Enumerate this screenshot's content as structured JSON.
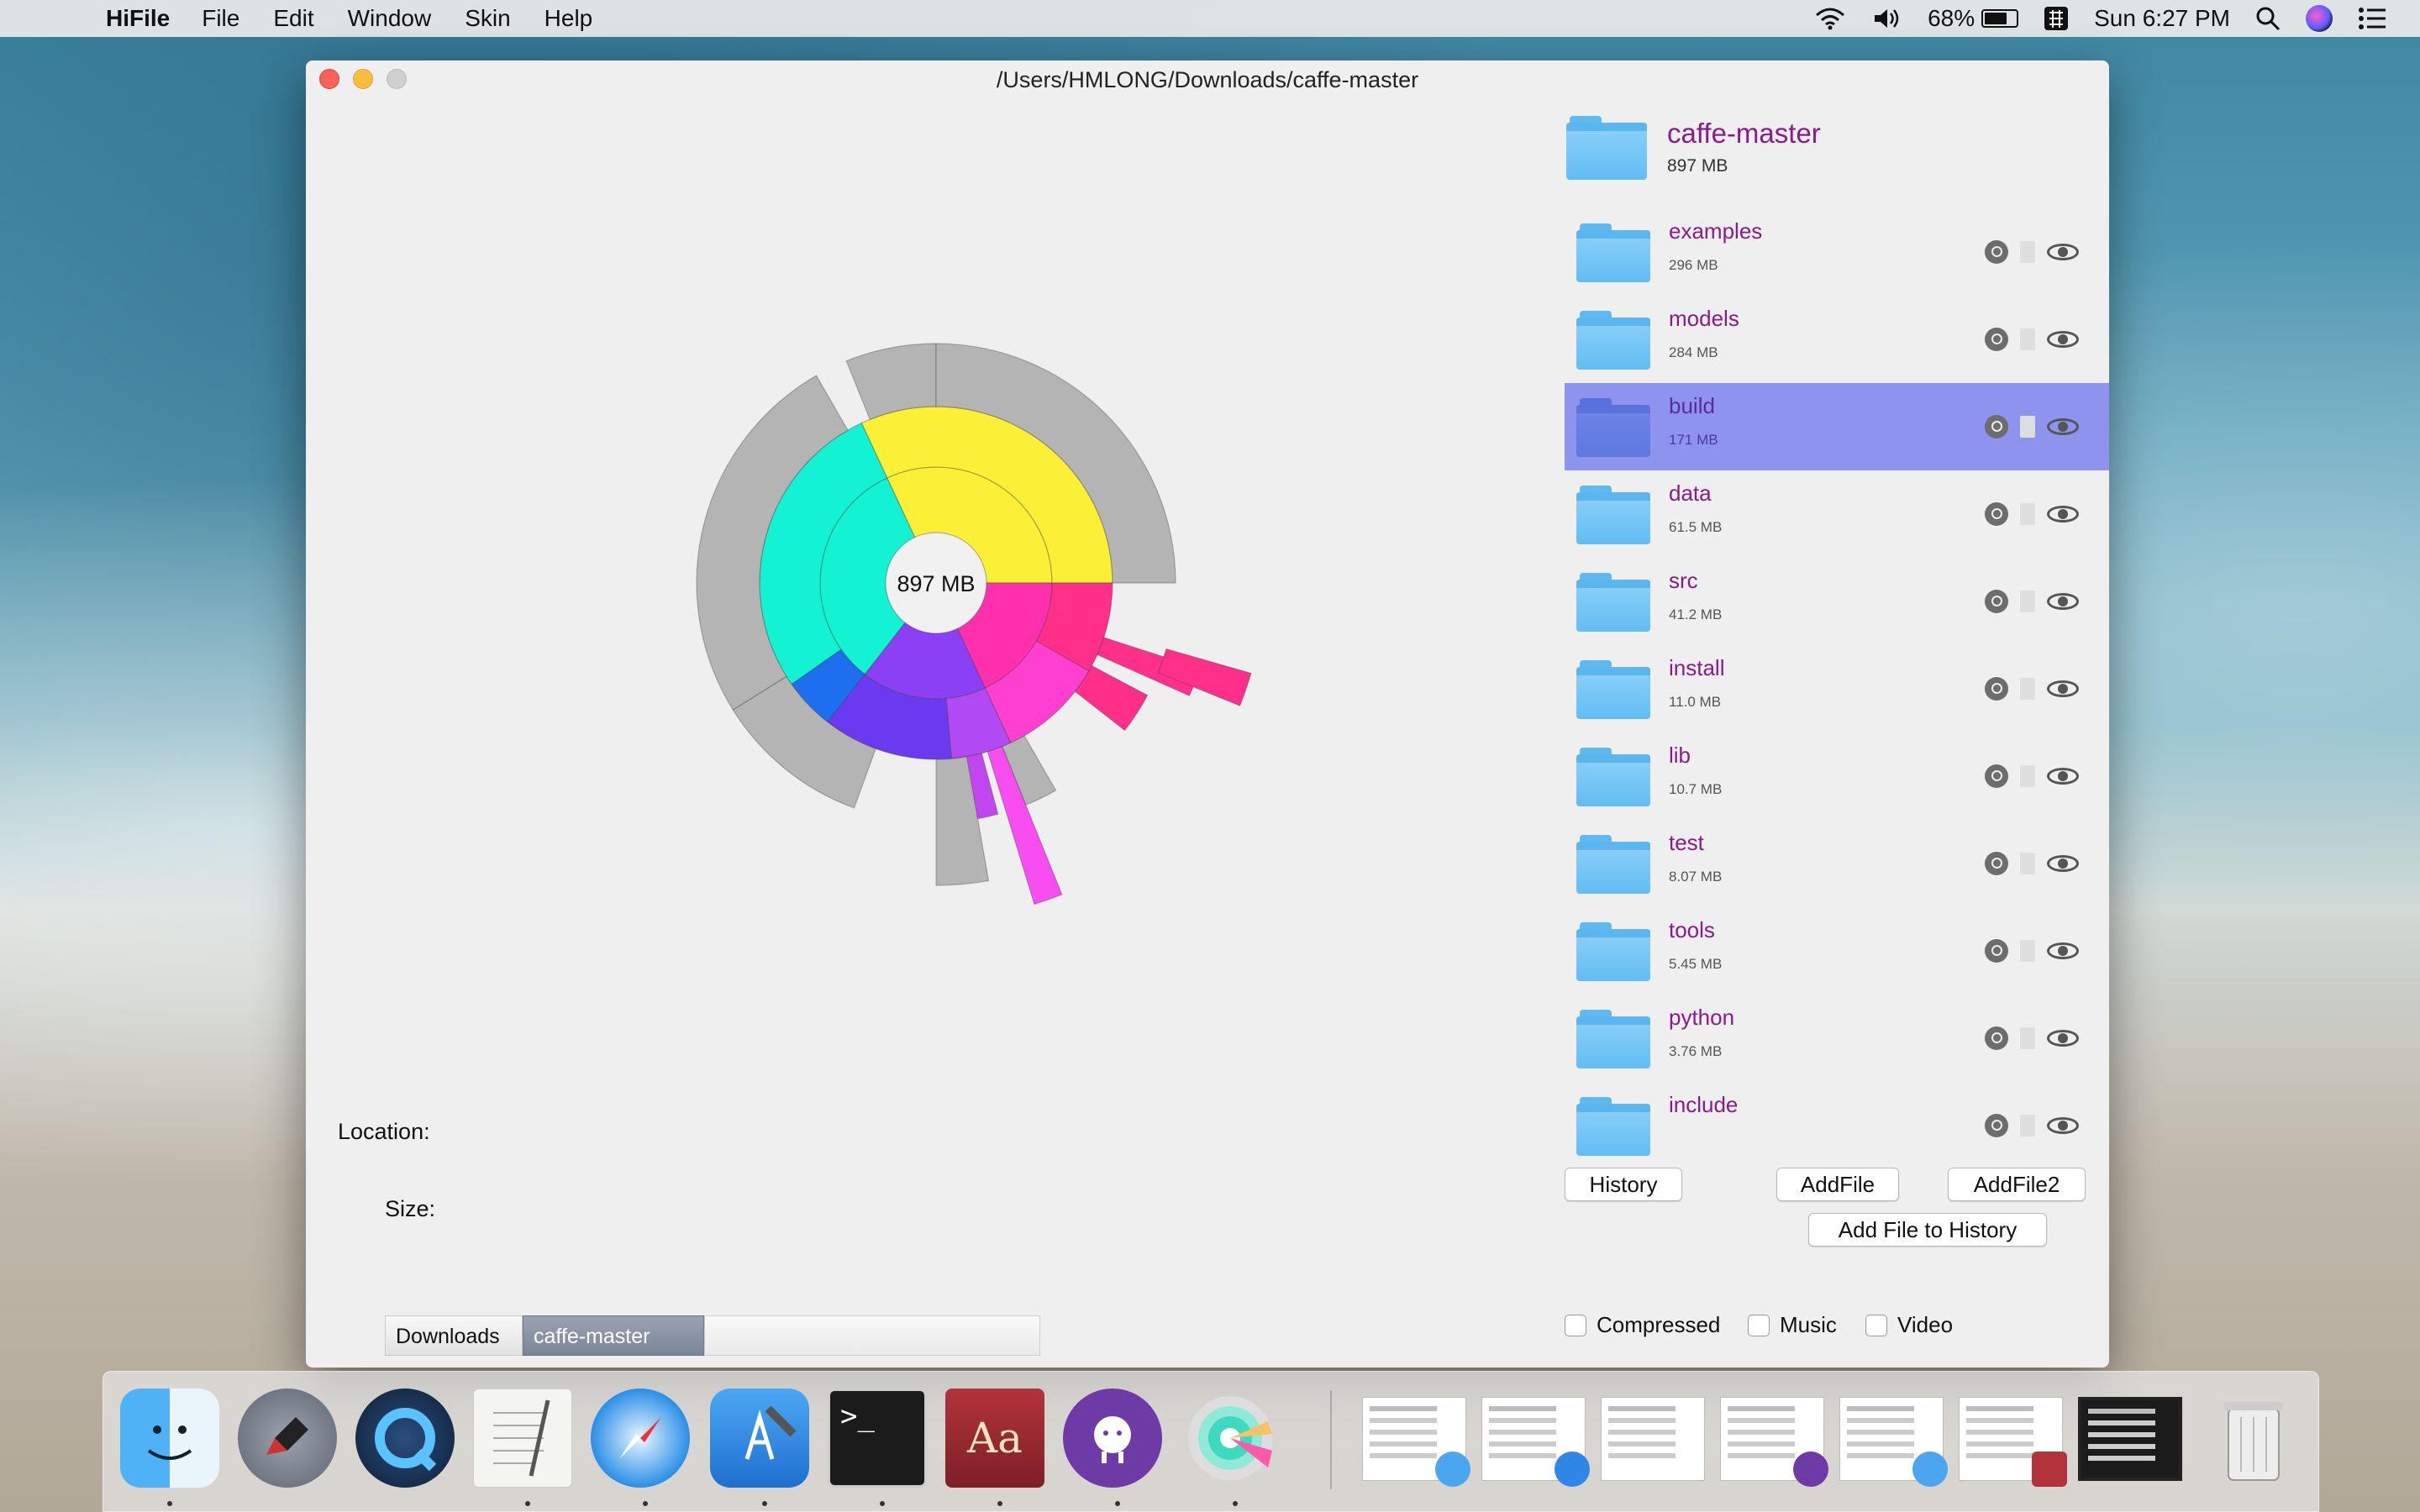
{
  "menubar": {
    "app_name": "HiFile",
    "items": [
      "File",
      "Edit",
      "Window",
      "Skin",
      "Help"
    ],
    "battery_percent": "68%",
    "battery_level": 0.68,
    "clock": "Sun 6:27 PM"
  },
  "window": {
    "title": "/Users/HMLONG/Downloads/caffe-master"
  },
  "sunburst": {
    "center_label": "897 MB"
  },
  "root_folder": {
    "name": "caffe-master",
    "size": "897 MB"
  },
  "folders": [
    {
      "name": "examples",
      "size": "296 MB",
      "selected": false
    },
    {
      "name": "models",
      "size": "284 MB",
      "selected": false
    },
    {
      "name": "build",
      "size": "171 MB",
      "selected": true
    },
    {
      "name": "data",
      "size": "61.5 MB",
      "selected": false
    },
    {
      "name": "src",
      "size": "41.2 MB",
      "selected": false
    },
    {
      "name": "install",
      "size": "11.0 MB",
      "selected": false
    },
    {
      "name": "lib",
      "size": "10.7 MB",
      "selected": false
    },
    {
      "name": "test",
      "size": "8.07 MB",
      "selected": false
    },
    {
      "name": "tools",
      "size": "5.45 MB",
      "selected": false
    },
    {
      "name": "python",
      "size": "3.76 MB",
      "selected": false
    },
    {
      "name": "include",
      "size": "",
      "selected": false
    }
  ],
  "info": {
    "location_label": "Location:",
    "size_label": "Size:"
  },
  "breadcrumb": {
    "parent": "Downloads",
    "current": "caffe-master"
  },
  "buttons": {
    "history": "History",
    "add_file": "AddFile",
    "add_file2": "AddFile2",
    "add_file_to_history": "Add File to History"
  },
  "filters": {
    "compressed": "Compressed",
    "music": "Music",
    "video": "Video"
  },
  "dock": {
    "apps": [
      "finder-icon",
      "launchpad-icon",
      "quicktime-icon",
      "textedit-icon",
      "safari-icon",
      "xcode-icon",
      "terminal-icon",
      "dictionary-icon",
      "github-desktop-icon",
      "hifile-icon"
    ],
    "terminal_glyph": ">_",
    "dictionary_glyph": "Aa"
  },
  "colors": {
    "accent_purple": "#8a1b8c",
    "selected_row": "#8e93ee"
  }
}
